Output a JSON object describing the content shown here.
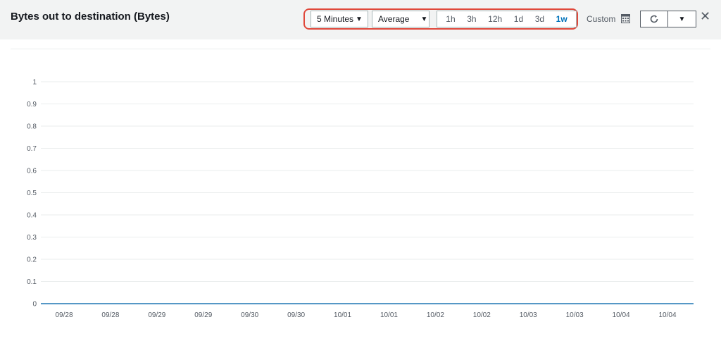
{
  "title": "Bytes out to destination (Bytes)",
  "controls": {
    "period": "5 Minutes",
    "statistic": "Average",
    "ranges": [
      "1h",
      "3h",
      "12h",
      "1d",
      "3d",
      "1w"
    ],
    "active_range": "1w",
    "custom_label": "Custom",
    "icons": {
      "dropdown": "caret-down-icon",
      "calendar": "calendar-icon",
      "refresh": "refresh-icon",
      "close": "close-icon"
    }
  },
  "colors": {
    "accent": "#0073bb",
    "series_line": "#1f77b4",
    "highlight_border": "#e0483b",
    "header_bg": "#f2f3f3"
  },
  "chart_data": {
    "type": "line",
    "title": "Bytes out to destination (Bytes)",
    "xlabel": "",
    "ylabel": "",
    "ylim": [
      0,
      1
    ],
    "y_ticks": [
      "0",
      "0.1",
      "0.2",
      "0.3",
      "0.4",
      "0.5",
      "0.6",
      "0.7",
      "0.8",
      "0.9",
      "1"
    ],
    "x_ticks": [
      "09/28",
      "09/28",
      "09/29",
      "09/29",
      "09/30",
      "09/30",
      "10/01",
      "10/01",
      "10/02",
      "10/02",
      "10/03",
      "10/03",
      "10/04",
      "10/04"
    ],
    "grid": true,
    "series": [
      {
        "x": [
          "09/28",
          "10/04"
        ],
        "values": [
          0,
          0
        ]
      }
    ]
  }
}
